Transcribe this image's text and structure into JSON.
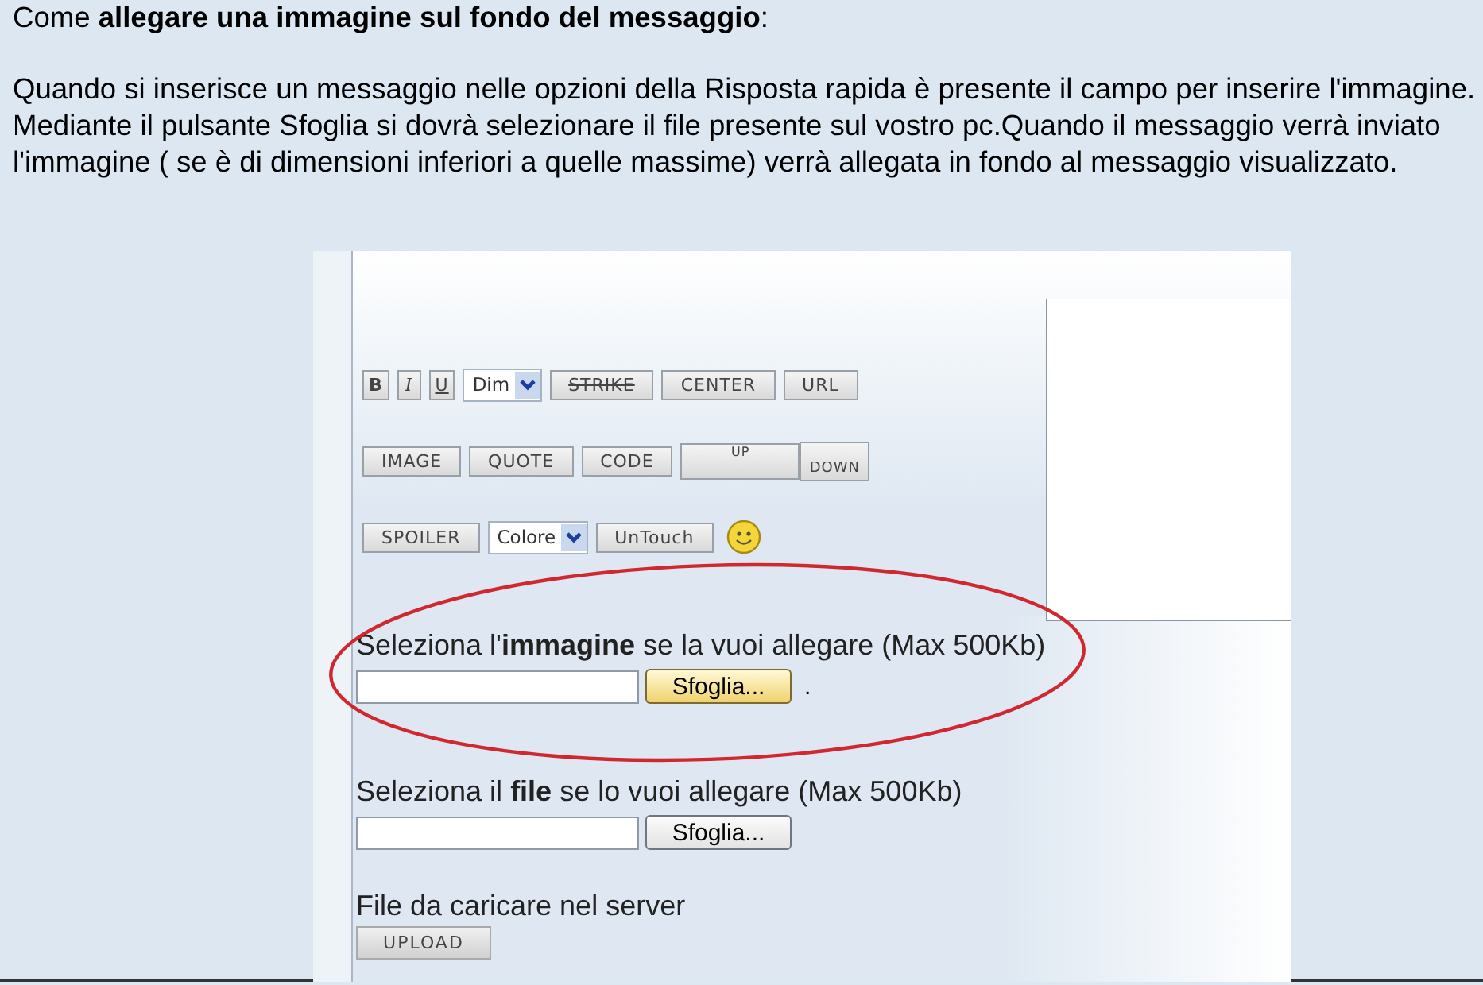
{
  "intro": {
    "title": "Come **allegare una immagine sul fondo del messaggio**:",
    "lines": [
      "Quando si inserisce un messaggio nelle opzioni della Risposta rapida è presente il campo per inserire l'immagine.",
      "Mediante il pulsante Sfoglia si dovrà selezionare il file presente sul vostro pc.Quando il messaggio verrà inviato",
      "l'immagine ( se è di dimensioni inferiori a quelle massime) verrà allegata in fondo al messaggio visualizzato."
    ]
  },
  "screenshot": {
    "toolbar_rows": [
      [
        {
          "kind": "bold",
          "label": "B"
        },
        {
          "kind": "italic",
          "label": "I"
        },
        {
          "kind": "underline",
          "label": "U"
        },
        {
          "kind": "select",
          "label": "Dim"
        },
        {
          "kind": "strike",
          "label": "STRIKE"
        },
        {
          "kind": "button",
          "label": "CENTER"
        },
        {
          "kind": "button",
          "label": "URL"
        }
      ],
      [
        {
          "kind": "button",
          "label": "IMAGE"
        },
        {
          "kind": "button",
          "label": "QUOTE"
        },
        {
          "kind": "button",
          "label": "CODE"
        },
        {
          "kind": "up",
          "label": "UP"
        },
        {
          "kind": "down",
          "label": "DOWN"
        }
      ],
      [
        {
          "kind": "button",
          "label": "SPOILER"
        },
        {
          "kind": "select",
          "label": "Colore"
        },
        {
          "kind": "button",
          "label": "UnTouch"
        },
        {
          "kind": "smiley"
        }
      ]
    ],
    "uploads": [
      {
        "label": "Seleziona l'**immagine** se la vuoi allegare (Max 500Kb)",
        "button": "Sfoglia...",
        "focused": true,
        "suffix": ".",
        "highlighted": true
      },
      {
        "label": "Seleziona il **file** se lo vuoi allegare (Max 500Kb)",
        "button": "Sfoglia...",
        "focused": false,
        "highlighted": false
      }
    ],
    "server": {
      "label": "File da caricare nel server",
      "button": "UPLOAD"
    }
  }
}
